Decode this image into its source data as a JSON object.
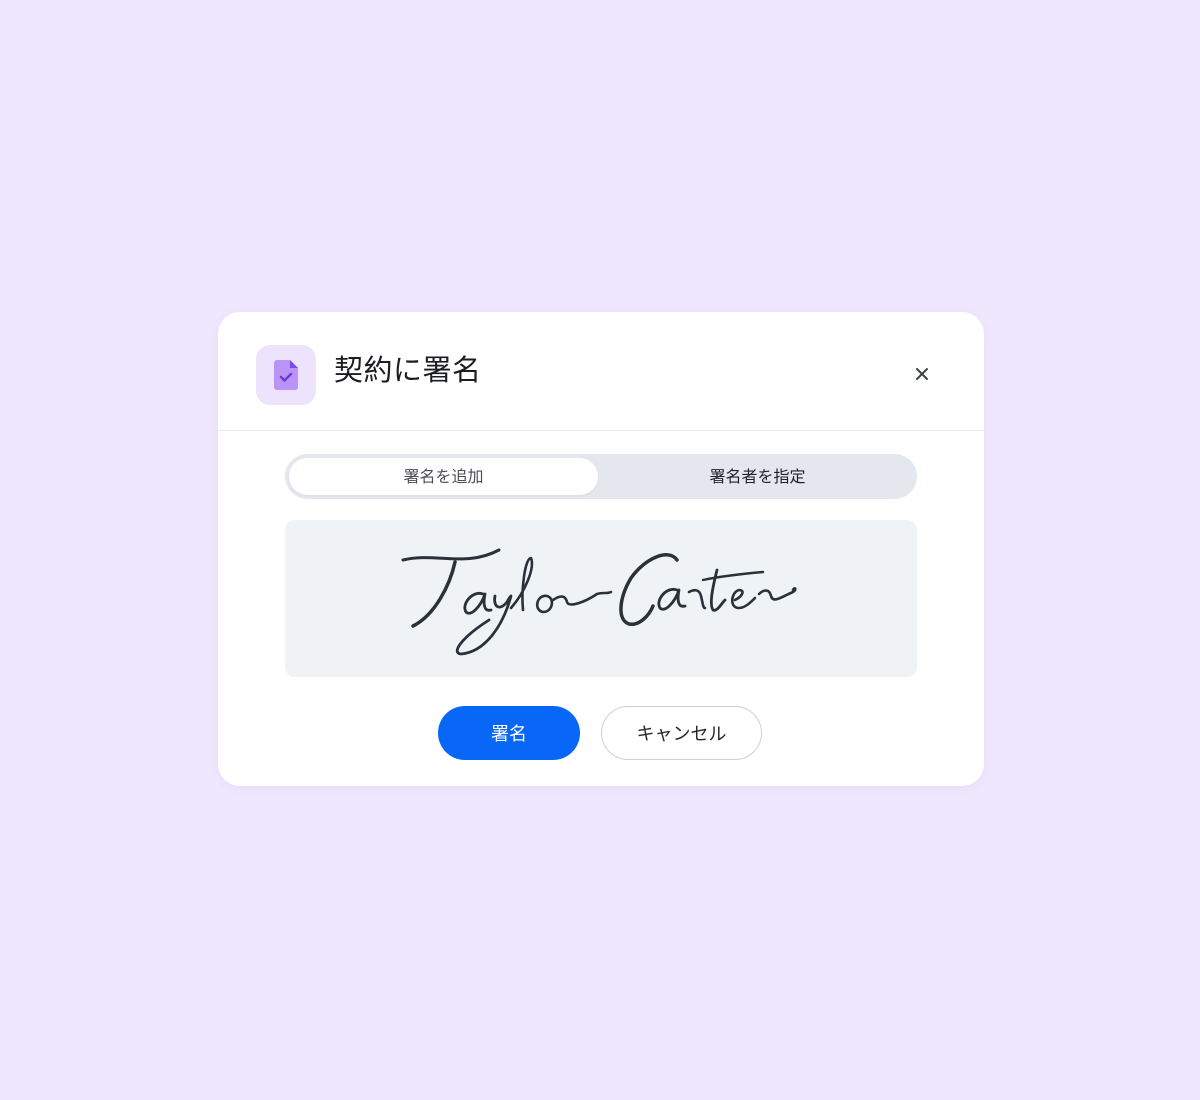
{
  "dialog": {
    "title": "契約に署名",
    "app_icon": "document-check-icon",
    "close_icon": "close-icon"
  },
  "tabs": [
    {
      "label": "署名を追加",
      "selected": true
    },
    {
      "label": "署名者を指定",
      "selected": false
    }
  ],
  "signature": {
    "text": "Taylor Carter",
    "style": "handwritten-script"
  },
  "actions": {
    "sign_label": "署名",
    "cancel_label": "キャンセル"
  },
  "colors": {
    "background": "#EEE7FD",
    "primary": "#0867F6",
    "icon_tile": "#EDE3FC",
    "icon_accent": "#9B6BF0",
    "signature_ink": "#2A3138"
  }
}
